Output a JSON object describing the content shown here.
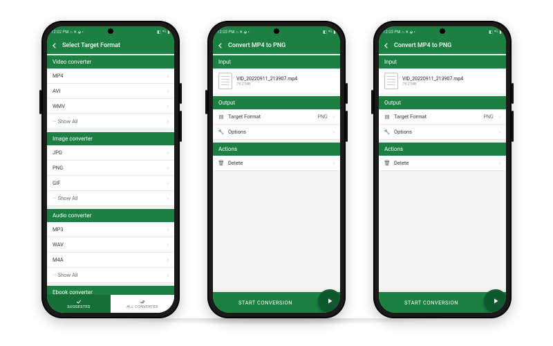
{
  "status": {
    "time1": "12:02 PM",
    "time2": "12:03 PM",
    "time3": "12:03 PM",
    "left_extra": "⌂ ✕ ⬙ •",
    "right": "◧ ⁴ᴳ ▮"
  },
  "p1": {
    "title": "Select Target Format",
    "sections": [
      {
        "header": "Video converter",
        "items": [
          "MP4",
          "AVI",
          "WMV"
        ],
        "show_all": "···  Show All"
      },
      {
        "header": "Image converter",
        "items": [
          "JPG",
          "PNG",
          "GIF"
        ],
        "show_all": "···  Show All"
      },
      {
        "header": "Audio converter",
        "items": [
          "MP3",
          "WAV",
          "M4A"
        ],
        "show_all": "···  Show All"
      },
      {
        "header": "Ebook converter"
      }
    ],
    "tabs": {
      "suggested": "SUGGESTED",
      "all": "ALL CONVERTER"
    }
  },
  "p2": {
    "title": "Convert MP4 to PNG",
    "input_h": "Input",
    "file": {
      "name": "VID_20220911_213907.mp4",
      "size": "79.2 MB"
    },
    "output_h": "Output",
    "target": {
      "label": "Target Format",
      "value": "PNG"
    },
    "options": "Options",
    "actions_h": "Actions",
    "delete": "Delete",
    "start": "START CONVERSION"
  },
  "p3": {
    "title": "Convert MP4 to PNG",
    "input_h": "Input",
    "file": {
      "name": "VID_20220911_213907.mp4",
      "size": "79.2 MB"
    },
    "output_h": "Output",
    "target": {
      "label": "Target Format",
      "value": "PNG"
    },
    "options": "Options",
    "actions_h": "Actions",
    "delete": "Delete",
    "start": "START CONVERSION"
  }
}
